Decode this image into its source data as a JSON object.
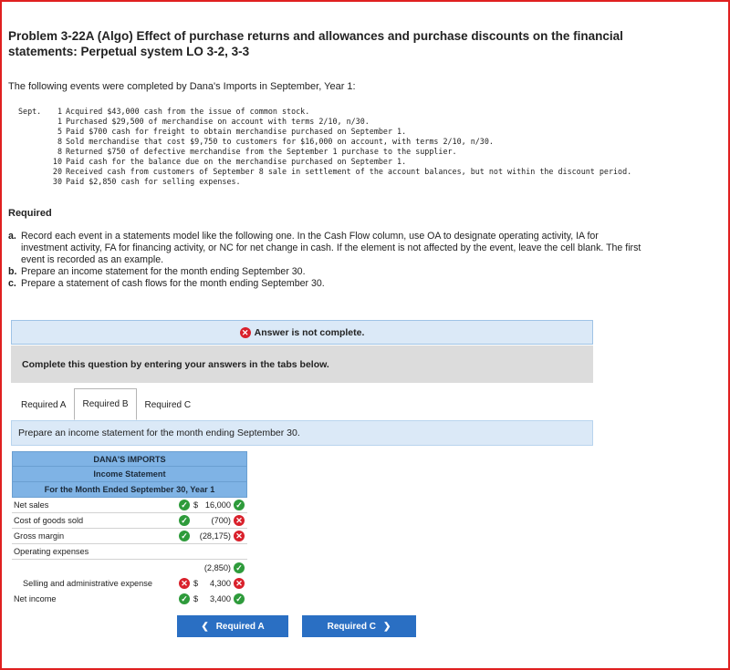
{
  "problem": {
    "title": "Problem 3-22A (Algo) Effect of purchase returns and allowances and purchase discounts on the financial statements: Perpetual system LO 3-2, 3-3",
    "intro": "The following events were completed by Dana's Imports in September, Year 1:",
    "events": [
      {
        "month": "Sept.",
        "day": "1",
        "text": "Acquired $43,000 cash from the issue of common stock."
      },
      {
        "month": "",
        "day": "1",
        "text": "Purchased $29,500 of merchandise on account with terms 2/10, n/30."
      },
      {
        "month": "",
        "day": "5",
        "text": "Paid $700 cash for freight to obtain merchandise purchased on September 1."
      },
      {
        "month": "",
        "day": "8",
        "text": "Sold merchandise that cost $9,750 to customers for $16,000 on account, with terms 2/10, n/30."
      },
      {
        "month": "",
        "day": "8",
        "text": "Returned $750 of defective merchandise from the September 1 purchase to the supplier."
      },
      {
        "month": "",
        "day": "10",
        "text": "Paid cash for the balance due on the merchandise purchased on September 1."
      },
      {
        "month": "",
        "day": "20",
        "text": "Received cash from customers of September 8 sale in settlement of the account balances, but not within the discount period."
      },
      {
        "month": "",
        "day": "30",
        "text": "Paid $2,850 cash for selling expenses."
      }
    ],
    "required_heading": "Required",
    "requirements": [
      {
        "letter": "a.",
        "text": "Record each event in a statements model like the following one. In the Cash Flow column, use OA to designate operating activity, IA for investment activity, FA for financing activity, or NC for net change in cash. If the element is not affected by the event, leave the cell blank. The first event is recorded as an example."
      },
      {
        "letter": "b.",
        "text": "Prepare an income statement for the month ending September 30."
      },
      {
        "letter": "c.",
        "text": "Prepare a statement of cash flows for the month ending September 30."
      }
    ]
  },
  "answer_status": "Answer is not complete.",
  "complete_instruction": "Complete this question by entering your answers in the tabs below.",
  "tabs": [
    {
      "label": "Required A",
      "active": false
    },
    {
      "label": "Required B",
      "active": true
    },
    {
      "label": "Required C",
      "active": false
    }
  ],
  "prompt": "Prepare an income statement for the month ending September 30.",
  "statement": {
    "company": "DANA'S IMPORTS",
    "name": "Income Statement",
    "period": "For the Month Ended September 30, Year 1",
    "rows": [
      {
        "label": "Net sales",
        "label_mark": "correct",
        "currency": "$",
        "value": "16,000",
        "value_mark": "correct"
      },
      {
        "label": "Cost of goods sold",
        "label_mark": "correct",
        "currency": "",
        "value": "(700)",
        "value_mark": "incorrect"
      },
      {
        "label": "Gross margin",
        "label_mark": "correct",
        "currency": "",
        "value": "(28,175)",
        "value_mark": "incorrect"
      },
      {
        "label": "Operating expenses",
        "label_mark": "",
        "currency": "",
        "value": "",
        "value_mark": ""
      },
      {
        "label": "",
        "label_mark": "",
        "currency": "",
        "value": "(2,850)",
        "value_mark": "correct"
      },
      {
        "label": "Selling and administrative expense",
        "label_mark": "incorrect",
        "currency": "$",
        "value": "4,300",
        "value_mark": "incorrect",
        "indent": true
      },
      {
        "label": "Net income",
        "label_mark": "correct",
        "currency": "$",
        "value": "3,400",
        "value_mark": "correct"
      }
    ]
  },
  "nav": {
    "prev_label": "Required A",
    "next_label": "Required C",
    "prev_icon": "chevron-left-icon",
    "next_icon": "chevron-right-icon"
  },
  "colors": {
    "frame": "#e02020",
    "header_blue": "#7fb3e5",
    "button_blue": "#2a6fc3",
    "correct": "#2e9b3b",
    "incorrect": "#d9202b"
  }
}
